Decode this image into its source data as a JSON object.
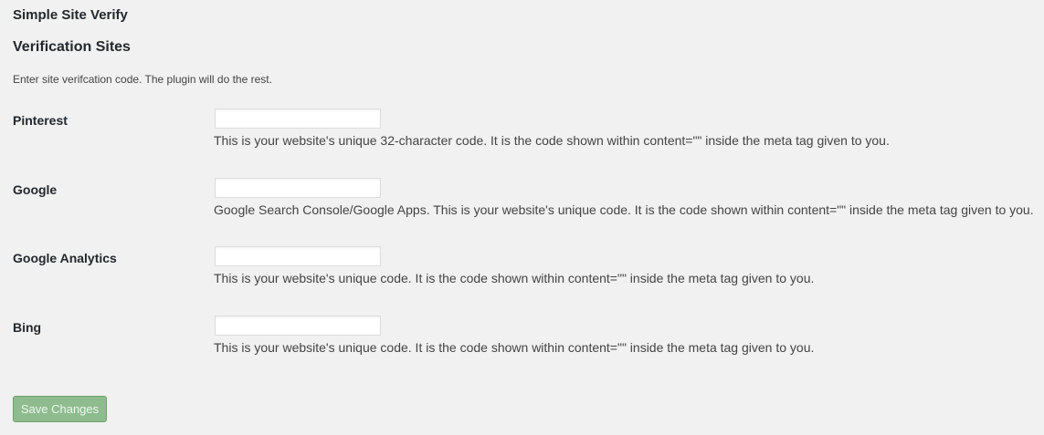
{
  "page": {
    "title": "Simple Site Verify"
  },
  "section": {
    "title": "Verification Sites",
    "description": "Enter site verifcation code. The plugin will do the rest."
  },
  "fields": [
    {
      "label": "Pinterest",
      "value": "",
      "description": "This is your website's unique 32-character code. It is the code shown within content=\"\" inside the meta tag given to you."
    },
    {
      "label": "Google",
      "value": "",
      "description": "Google Search Console/Google Apps. This is your website's unique code. It is the code shown within content=\"\" inside the meta tag given to you."
    },
    {
      "label": "Google Analytics",
      "value": "",
      "description": "This is your website's unique code. It is the code shown within content=\"\" inside the meta tag given to you."
    },
    {
      "label": "Bing",
      "value": "",
      "description": "This is your website's unique code. It is the code shown within content=\"\" inside the meta tag given to you."
    }
  ],
  "actions": {
    "save_label": "Save Changes"
  },
  "colors": {
    "background": "#f1f1f1",
    "save_button": "#8fbc8f"
  }
}
